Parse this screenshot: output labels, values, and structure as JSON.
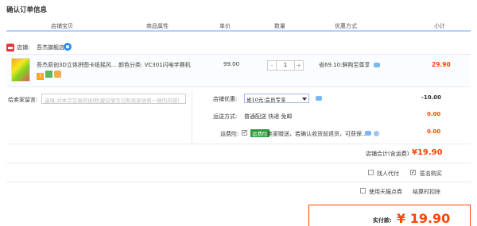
{
  "page_title": "确认订单信息",
  "columns": [
    "店铺宝贝",
    "商品属性",
    "单价",
    "数量",
    "优惠方式",
    "小计"
  ],
  "shop": {
    "label": "店铺:",
    "name": "吾杰旗舰店"
  },
  "item": {
    "name": "吾杰原创3D立体拼图卡纸摇风...",
    "badge": "7",
    "sku": "颜色分类: VC301闪电字赛机",
    "price": "99.00",
    "quantity": "1",
    "minus": "-",
    "plus": "+",
    "saving": "省69.10:鲜购至尊享",
    "subtotal": "29.90"
  },
  "note": {
    "label": "给卖家留言:",
    "placeholder": "选填:对本次交易的说明(建议填写已和卖家协商一致的内容)"
  },
  "promo": {
    "label": "店铺优惠:",
    "selected": "省10元:会员专享",
    "amount": "-10.00"
  },
  "shipping": {
    "label": "运送方式:",
    "value": "普通配送 快递 免邮",
    "amount": "0.00"
  },
  "insurance": {
    "label": "运费险:",
    "tag": "运费险",
    "text": "卖家赠送，若确认收货前退货，可获保...",
    "amount": "0.00"
  },
  "total": {
    "label": "店铺合计(含运费)",
    "value": "¥19.90"
  },
  "options": {
    "anonymous_pay": "找人代付",
    "anonymous_buy": "匿名购买",
    "tmall_points": "使用天猫点券",
    "settle": "结算时扣除"
  },
  "pay": {
    "label": "实付款:",
    "value": "¥ 19.90"
  }
}
